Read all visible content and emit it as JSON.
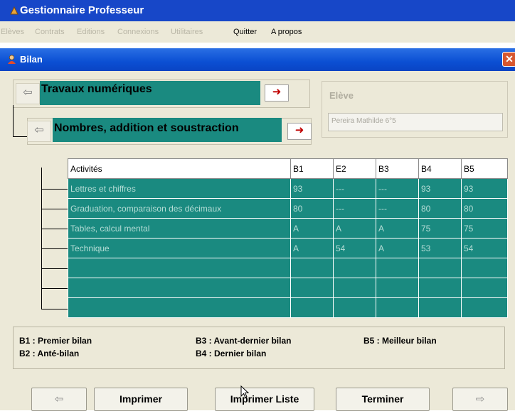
{
  "app": {
    "title": "Gestionnaire Professeur"
  },
  "menu": [
    {
      "label": "Elèves",
      "enabled": false
    },
    {
      "label": "Contrats",
      "enabled": false
    },
    {
      "label": "Editions",
      "enabled": false
    },
    {
      "label": "Connexions",
      "enabled": false
    },
    {
      "label": "Utilitaires",
      "enabled": false
    },
    {
      "label": "Quitter",
      "enabled": true
    },
    {
      "label": "A propos",
      "enabled": true
    }
  ],
  "dialog": {
    "title": "Bilan",
    "close_icon": "close-icon"
  },
  "topics": {
    "domain": "Travaux numériques",
    "subdomain": "Nombres, addition et soustraction"
  },
  "student": {
    "label": "Elève",
    "value": "Pereira Mathilde    6°5"
  },
  "grid": {
    "columns": [
      "Activités",
      "B1",
      "E2",
      "B3",
      "B4",
      "B5"
    ],
    "rows": [
      [
        "Lettres et chiffres",
        "93",
        "---",
        "---",
        "93",
        "93"
      ],
      [
        "Graduation, comparaison des décimaux",
        "80",
        "---",
        "---",
        "80",
        "80"
      ],
      [
        "Tables, calcul mental",
        "A",
        "A",
        "A",
        "75",
        "75"
      ],
      [
        "Technique",
        "A",
        "54",
        "A",
        "53",
        "54"
      ],
      [
        "",
        "",
        "",
        "",
        "",
        ""
      ],
      [
        "",
        "",
        "",
        "",
        "",
        ""
      ],
      [
        "",
        "",
        "",
        "",
        "",
        ""
      ]
    ]
  },
  "legend": {
    "b1": "B1 : Premier bilan",
    "b2": "B2 : Anté-bilan",
    "b3": "B3 : Avant-dernier bilan",
    "b4": "B4 : Dernier bilan",
    "b5": "B5 : Meilleur bilan"
  },
  "buttons": {
    "prev_icon": "arrow-left-icon",
    "print": "Imprimer",
    "print_list": "Imprimer Liste",
    "finish": "Terminer",
    "next_icon": "arrow-right-icon"
  },
  "colors": {
    "teal": "#1a8a80",
    "title_blue": "#0b4fd3",
    "face": "#ece9d8"
  }
}
